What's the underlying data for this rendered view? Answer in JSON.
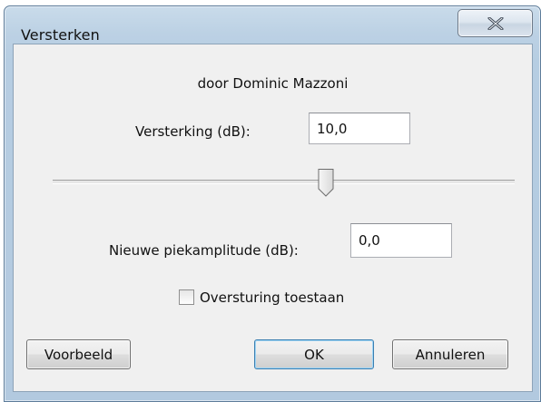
{
  "window": {
    "title": "Versterken"
  },
  "dialog": {
    "author": "door Dominic Mazzoni",
    "amplification": {
      "label": "Versterking (dB):",
      "value": "10,0"
    },
    "slider": {
      "min": 0,
      "max": 100,
      "value": 58
    },
    "peak": {
      "label": "Nieuwe piekamplitude (dB):",
      "value": "0,0"
    },
    "clipping": {
      "label": "Oversturing toestaan",
      "checked": false
    }
  },
  "buttons": {
    "preview": "Voorbeeld",
    "ok": "OK",
    "cancel": "Annuleren"
  },
  "icons": {
    "close": "close-x-icon",
    "slider_thumb": "slider-thumb-icon"
  }
}
